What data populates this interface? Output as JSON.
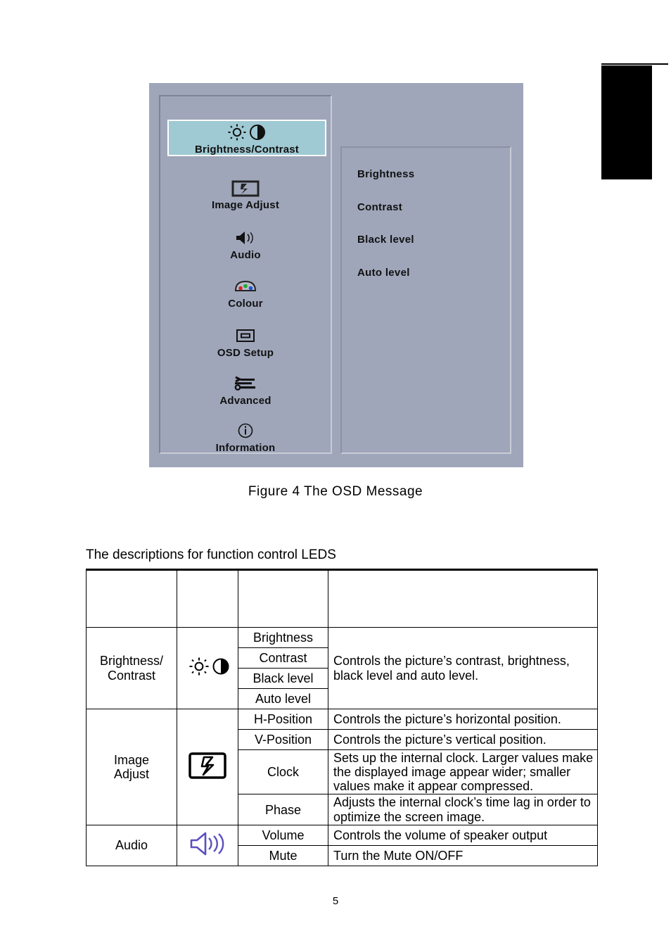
{
  "page": {
    "number": "5"
  },
  "figure": {
    "caption": "Figure 4   The  OSD  Message"
  },
  "osd": {
    "background_color": "#9fa6ba",
    "highlight_color": "#9fc9d3",
    "menu": [
      {
        "label": "Brightness/Contrast",
        "icon": "brightness-contrast-icon",
        "selected": true
      },
      {
        "label": "Image Adjust",
        "icon": "image-adjust-icon",
        "selected": false
      },
      {
        "label": "Audio",
        "icon": "audio-speaker-icon",
        "selected": false
      },
      {
        "label": "Colour",
        "icon": "colour-palette-icon",
        "selected": false
      },
      {
        "label": "OSD Setup",
        "icon": "osd-setup-icon",
        "selected": false
      },
      {
        "label": "Advanced",
        "icon": "advanced-tools-icon",
        "selected": false
      },
      {
        "label": "Information",
        "icon": "information-icon",
        "selected": false
      }
    ],
    "submenu": [
      {
        "label": "Brightness"
      },
      {
        "label": "Contrast"
      },
      {
        "label": "Black level"
      },
      {
        "label": "Auto level"
      }
    ]
  },
  "leds_section": {
    "heading": "The descriptions for function control LEDS",
    "table": {
      "header": [
        "",
        "",
        "",
        ""
      ],
      "groups": [
        {
          "name": "Brightness/\nContrast",
          "icon": "brightness-contrast-icon",
          "items": [
            "Brightness",
            "Contrast",
            "Black level",
            "Auto level"
          ],
          "description": "Controls the picture’s contrast, brightness, black level and auto level."
        },
        {
          "name": "Image\nAdjust",
          "icon": "image-adjust-icon",
          "rows": [
            {
              "item": "H-Position",
              "description": "Controls the picture’s horizontal position."
            },
            {
              "item": "V-Position",
              "description": "Controls the picture’s vertical position."
            },
            {
              "item": "Clock",
              "description": "Sets up the internal clock. Larger values make the displayed image appear wider; smaller values make it appear compressed."
            },
            {
              "item": "Phase",
              "description": "Adjusts the internal clock’s time lag in order to optimize the screen image."
            }
          ]
        },
        {
          "name": "Audio",
          "icon": "audio-speaker-icon",
          "rows": [
            {
              "item": "Volume",
              "description": "Controls the volume of speaker output"
            },
            {
              "item": "Mute",
              "description": "Turn the Mute ON/OFF"
            }
          ]
        }
      ]
    }
  }
}
